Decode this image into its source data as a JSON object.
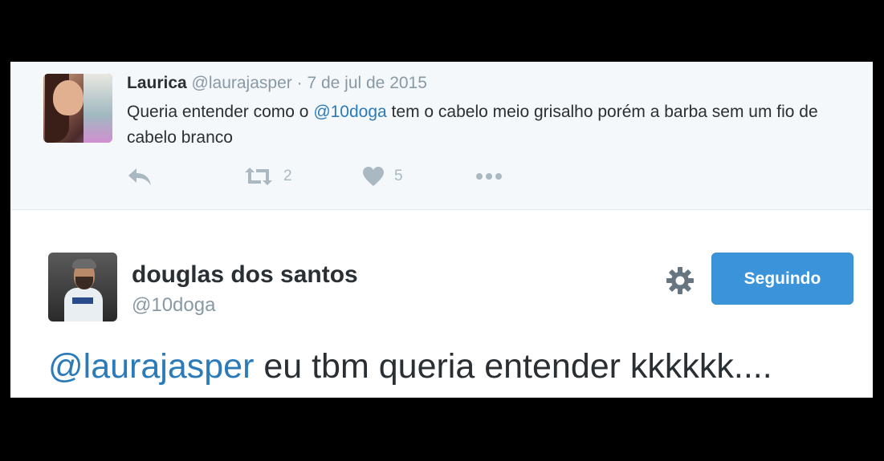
{
  "context_tweet": {
    "name": "Laurica",
    "handle": "@laurajasper",
    "separator": "·",
    "date": "7 de jul de 2015",
    "text_before": "Queria entender como o ",
    "mention": "@10doga",
    "text_after": " tem o cabelo meio grisalho porém a barba sem um fio de cabelo branco",
    "actions": {
      "reply_icon": "reply-icon",
      "retweet_icon": "retweet-icon",
      "retweet_count": "2",
      "like_icon": "heart-icon",
      "like_count": "5",
      "more_icon": "more-icon"
    }
  },
  "main_tweet": {
    "name": "douglas dos santos",
    "handle": "@10doga",
    "follow_button": "Seguindo",
    "settings_icon": "gear-icon",
    "mention": "@laurajasper",
    "text": " eu tbm queria entender kkkkkk...."
  },
  "colors": {
    "link": "#2b7bb9",
    "button": "#3b94d9",
    "muted": "#8899a6",
    "text": "#292f33",
    "context_bg": "#f5f8fa"
  }
}
